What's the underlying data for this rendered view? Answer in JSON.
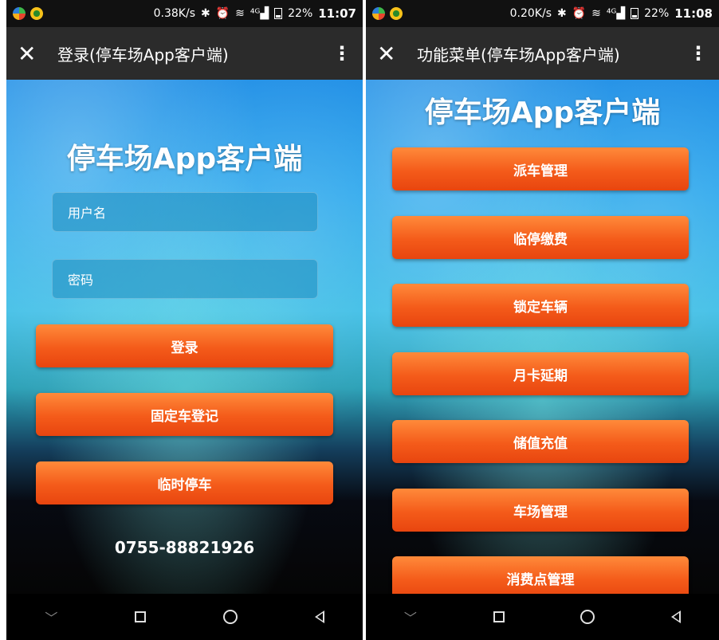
{
  "left": {
    "status": {
      "speed": "0.38K/s",
      "battery": "22%",
      "time": "11:07"
    },
    "title": "登录(停车场App客户端)",
    "app_title": "停车场App客户端",
    "username_placeholder": "用户名",
    "password_placeholder": "密码",
    "buttons": {
      "login": "登录",
      "fixed_register": "固定车登记",
      "temp_parking": "临时停车"
    },
    "phone": "0755-88821926"
  },
  "right": {
    "status": {
      "speed": "0.20K/s",
      "battery": "22%",
      "time": "11:08"
    },
    "title": "功能菜单(停车场App客户端)",
    "app_title": "停车场App客户端",
    "menu": [
      "派车管理",
      "临停缴费",
      "锁定车辆",
      "月卡延期",
      "储值充值",
      "车场管理",
      "消费点管理"
    ]
  },
  "glyphs": {
    "close": "✕",
    "more": "⋮",
    "bluetooth": "✱",
    "alarm": "⏰",
    "wifi": "≋",
    "signal": "⁴ᴳ▟",
    "chevron": "﹀"
  }
}
